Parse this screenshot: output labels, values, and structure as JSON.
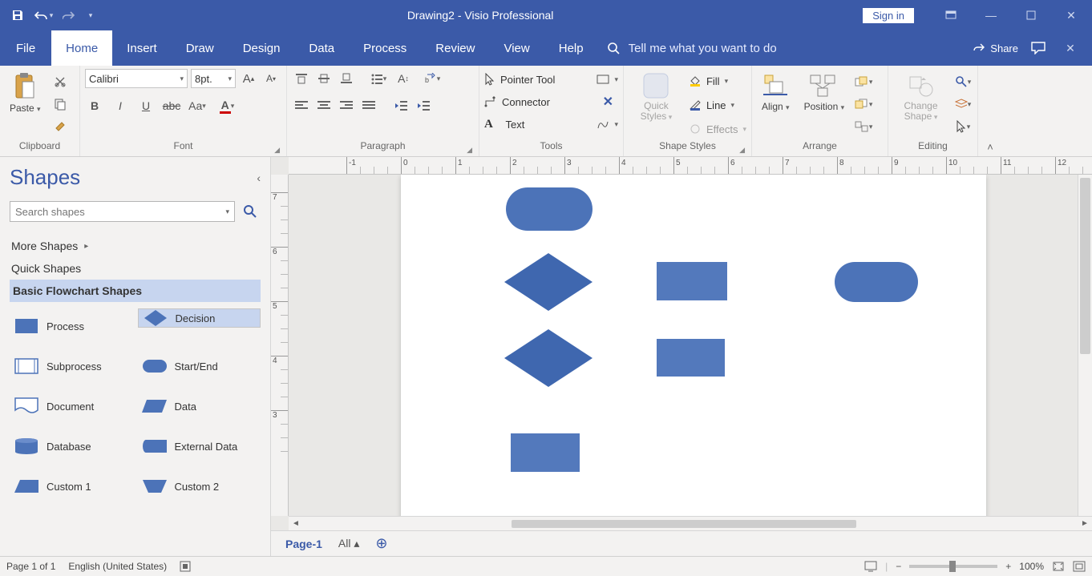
{
  "title": "Drawing2  -  Visio Professional",
  "signin": "Sign in",
  "tabs": [
    "File",
    "Home",
    "Insert",
    "Draw",
    "Design",
    "Data",
    "Process",
    "Review",
    "View",
    "Help"
  ],
  "tellme_placeholder": "Tell me what you want to do",
  "share": "Share",
  "ribbon": {
    "clipboard": {
      "paste": "Paste",
      "label": "Clipboard"
    },
    "font": {
      "name": "Calibri",
      "size": "8pt.",
      "label": "Font"
    },
    "paragraph": {
      "label": "Paragraph"
    },
    "tools": {
      "pointer": "Pointer Tool",
      "connector": "Connector",
      "text": "Text",
      "label": "Tools"
    },
    "shapestyles": {
      "quick": "Quick Styles",
      "fill": "Fill",
      "line": "Line",
      "effects": "Effects",
      "label": "Shape Styles"
    },
    "arrange": {
      "align": "Align",
      "position": "Position",
      "label": "Arrange"
    },
    "editing": {
      "change": "Change Shape",
      "label": "Editing"
    }
  },
  "shapes": {
    "title": "Shapes",
    "search_placeholder": "Search shapes",
    "more": "More Shapes",
    "quick": "Quick Shapes",
    "basic": "Basic Flowchart Shapes",
    "items": [
      "Process",
      "Decision",
      "Subprocess",
      "Start/End",
      "Document",
      "Data",
      "Database",
      "External Data",
      "Custom 1",
      "Custom 2"
    ]
  },
  "hruler": [
    -1,
    0,
    1,
    2,
    3,
    4,
    5,
    6,
    7,
    8,
    9,
    10,
    11,
    12
  ],
  "vruler": [
    7,
    6,
    5,
    4,
    3
  ],
  "pagetab": "Page-1",
  "all": "All",
  "status": {
    "page": "Page 1 of 1",
    "lang": "English (United States)",
    "zoom": "100%"
  }
}
